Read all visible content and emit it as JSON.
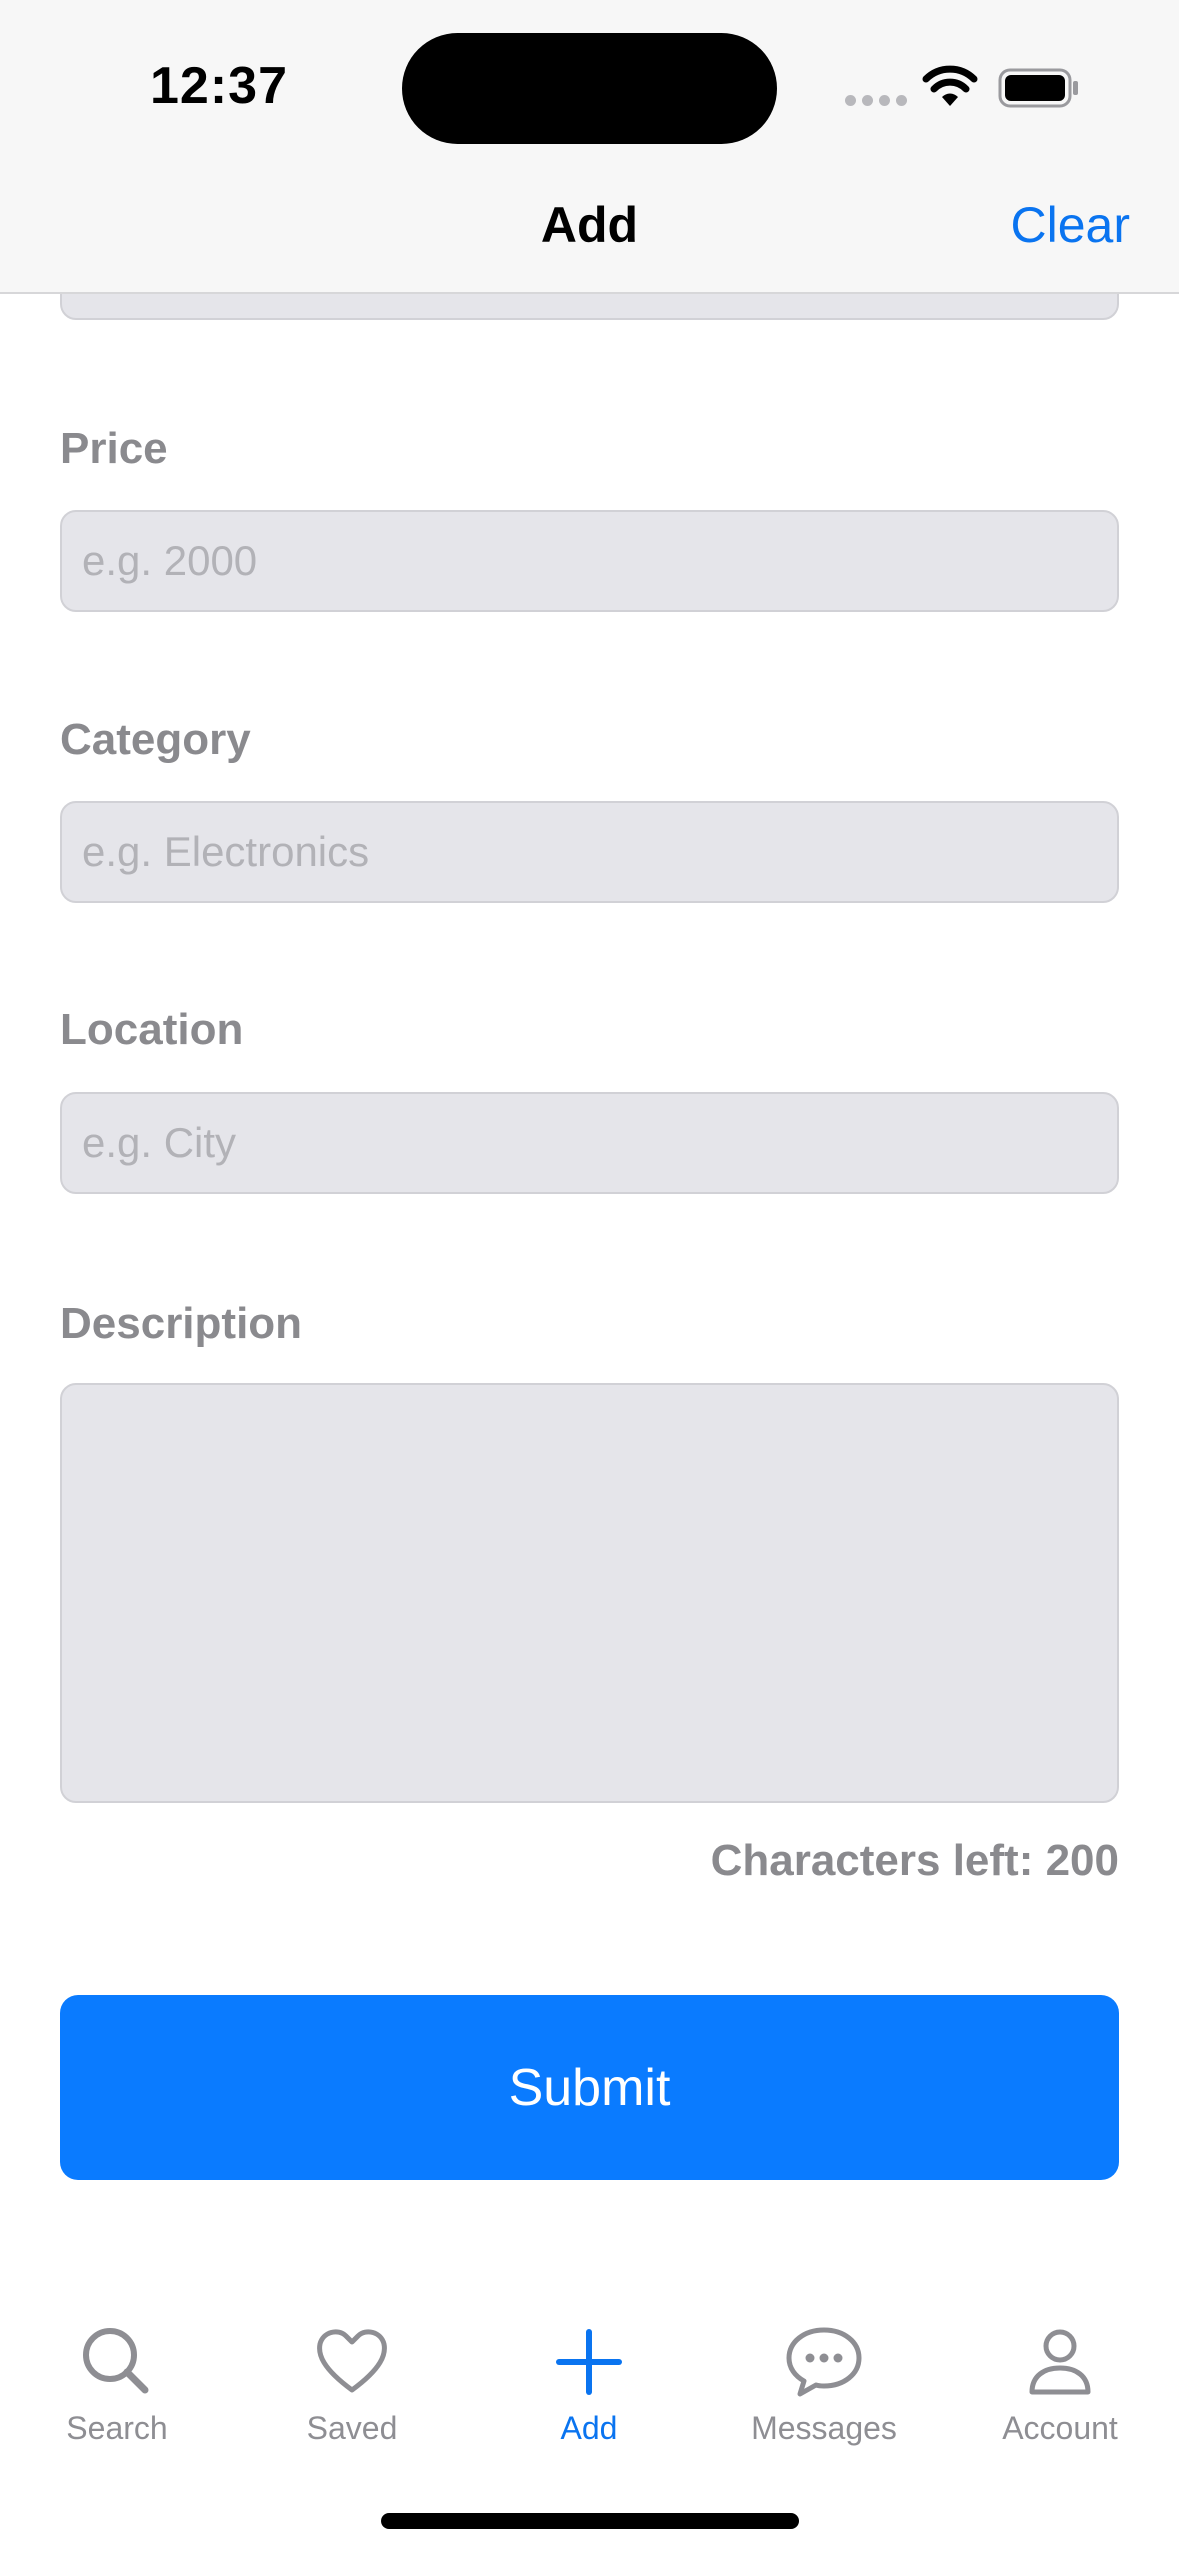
{
  "status_bar": {
    "time": "12:37"
  },
  "nav": {
    "title": "Add",
    "clear_label": "Clear"
  },
  "form": {
    "price": {
      "label": "Price",
      "placeholder": "e.g. 2000",
      "value": ""
    },
    "category": {
      "label": "Category",
      "placeholder": "e.g. Electronics",
      "value": ""
    },
    "location": {
      "label": "Location",
      "placeholder": "e.g. City",
      "value": ""
    },
    "description": {
      "label": "Description",
      "value": ""
    },
    "chars_left": "Characters left: 200",
    "submit_label": "Submit"
  },
  "tabbar": {
    "items": [
      {
        "label": "Search",
        "icon": "search-icon",
        "active": false
      },
      {
        "label": "Saved",
        "icon": "heart-icon",
        "active": false
      },
      {
        "label": "Add",
        "icon": "plus-icon",
        "active": true
      },
      {
        "label": "Messages",
        "icon": "chat-bubble-icon",
        "active": false
      },
      {
        "label": "Account",
        "icon": "person-icon",
        "active": false
      }
    ]
  },
  "colors": {
    "accent": "#0A7BFF",
    "label_gray": "#8A8A8E",
    "field_bg": "#E5E5EA"
  }
}
